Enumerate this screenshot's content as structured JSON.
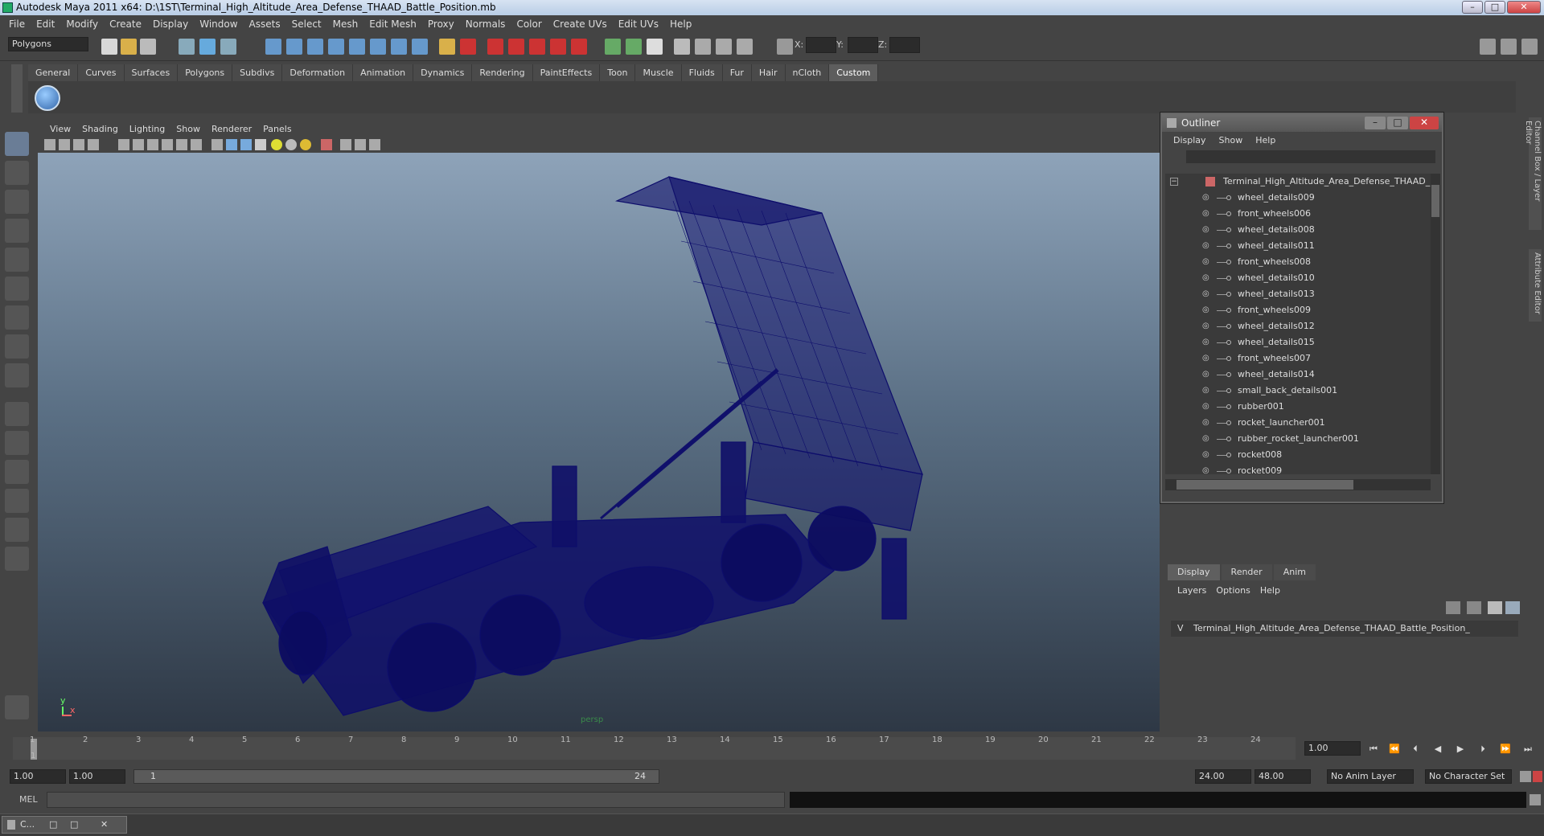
{
  "window": {
    "title": "Autodesk Maya 2011 x64: D:\\1ST\\Terminal_High_Altitude_Area_Defense_THAAD_Battle_Position.mb",
    "minimize": "–",
    "maximize": "□",
    "close": "✕"
  },
  "menubar": [
    "File",
    "Edit",
    "Modify",
    "Create",
    "Display",
    "Window",
    "Assets",
    "Select",
    "Mesh",
    "Edit Mesh",
    "Proxy",
    "Normals",
    "Color",
    "Create UVs",
    "Edit UVs",
    "Help"
  ],
  "statusline": {
    "mode": "Polygons",
    "x_label": "X:",
    "y_label": "Y:",
    "z_label": "Z:"
  },
  "shelf_tabs": [
    "General",
    "Curves",
    "Surfaces",
    "Polygons",
    "Subdivs",
    "Deformation",
    "Animation",
    "Dynamics",
    "Rendering",
    "PaintEffects",
    "Toon",
    "Muscle",
    "Fluids",
    "Fur",
    "Hair",
    "nCloth",
    "Custom"
  ],
  "shelf_active": "Custom",
  "viewport": {
    "menu": [
      "View",
      "Shading",
      "Lighting",
      "Show",
      "Renderer",
      "Panels"
    ],
    "camera_label": "persp",
    "axis_y": "y",
    "axis_x": "x"
  },
  "outliner": {
    "title": "Outliner",
    "menu": [
      "Display",
      "Show",
      "Help"
    ],
    "root": "Terminal_High_Altitude_Area_Defense_THAAD_Bat",
    "items": [
      "wheel_details009",
      "front_wheels006",
      "wheel_details008",
      "wheel_details011",
      "front_wheels008",
      "wheel_details010",
      "wheel_details013",
      "front_wheels009",
      "wheel_details012",
      "wheel_details015",
      "front_wheels007",
      "wheel_details014",
      "small_back_details001",
      "rubber001",
      "rocket_launcher001",
      "rubber_rocket_launcher001",
      "rocket008",
      "rocket009"
    ]
  },
  "side_tabs": [
    "Channel Box / Layer Editor",
    "Attribute Editor"
  ],
  "layer_editor": {
    "tabs": [
      "Display",
      "Render",
      "Anim"
    ],
    "active_tab": "Display",
    "menu": [
      "Layers",
      "Options",
      "Help"
    ],
    "layer_visible": "V",
    "layer_name": "Terminal_High_Altitude_Area_Defense_THAAD_Battle_Position_"
  },
  "timeline": {
    "ticks": [
      "1",
      "2",
      "3",
      "4",
      "5",
      "6",
      "7",
      "8",
      "9",
      "10",
      "11",
      "12",
      "13",
      "14",
      "15",
      "16",
      "17",
      "18",
      "19",
      "20",
      "21",
      "22",
      "23",
      "24"
    ],
    "current_frame_marker": "1",
    "current_frame": "1.00"
  },
  "range": {
    "start": "1.00",
    "playback_start": "1.00",
    "slider_start": "1",
    "slider_end": "24",
    "playback_end": "24.00",
    "end": "48.00",
    "anim_layer": "No Anim Layer",
    "character_set": "No Character Set"
  },
  "command": {
    "label": "MEL"
  },
  "taskbar": {
    "item": "C..."
  },
  "colors": {
    "wireframe": "#0d0d6b",
    "viewport_top": "#8ea3b9",
    "viewport_bottom": "#2e3845",
    "ui_bg": "#444444"
  }
}
